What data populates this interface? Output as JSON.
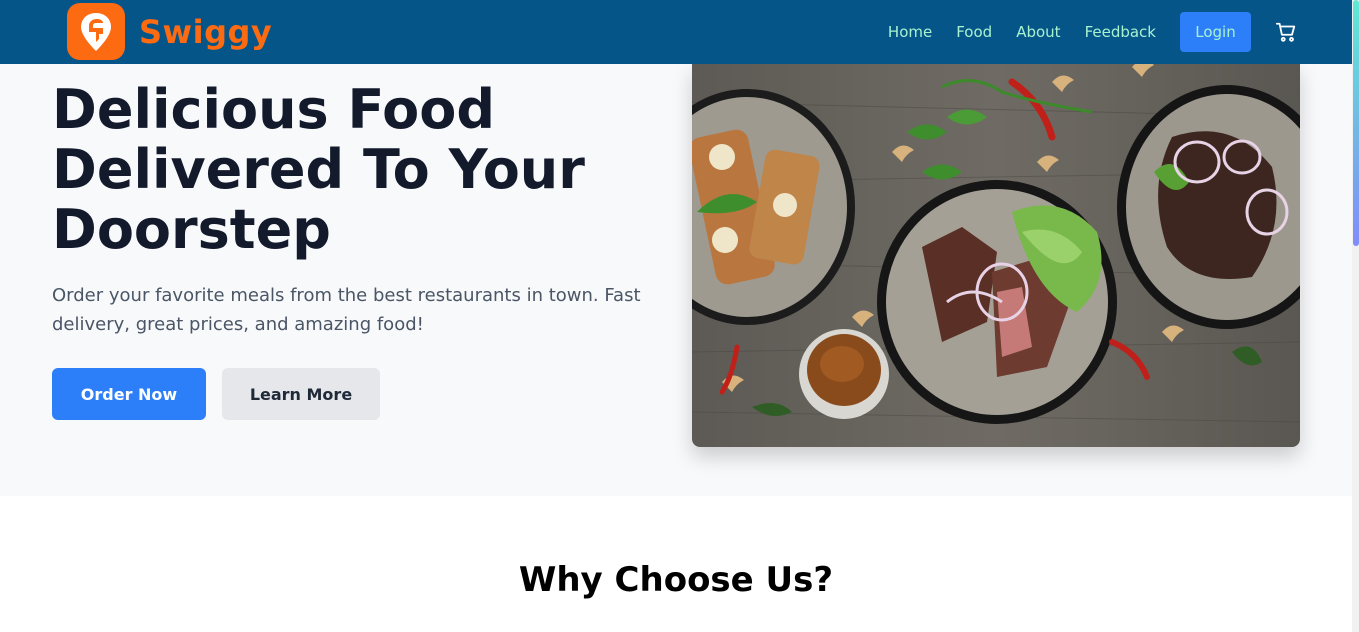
{
  "brand": {
    "name": "Swiggy",
    "logo_icon": "swiggy-logo-icon",
    "color": "#fc6a12"
  },
  "nav": {
    "links": [
      "Home",
      "Food",
      "About",
      "Feedback"
    ],
    "login_label": "Login",
    "cart_icon": "cart-icon",
    "bg_color": "#065589",
    "link_color": "#a7f3d0"
  },
  "hero": {
    "title_lines": [
      "Delicious Food",
      "Delivered To Your",
      "Doorstep"
    ],
    "subtitle": "Order your favorite meals from the best restaurants in town. Fast delivery, great prices, and amazing food!",
    "order_button": "Order Now",
    "learn_button": "Learn More"
  },
  "why": {
    "title": "Why Choose Us?"
  }
}
